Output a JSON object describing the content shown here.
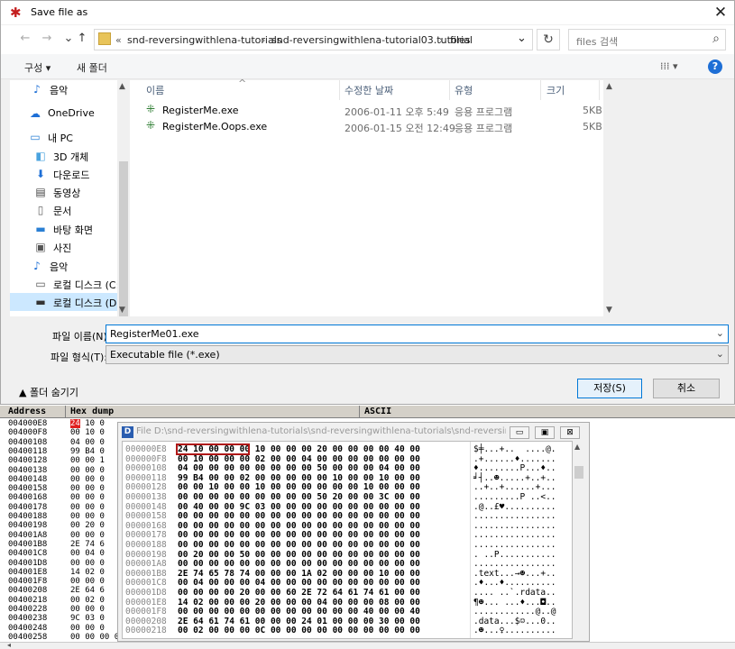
{
  "dialog": {
    "title": "Save file as",
    "close_glyph": "✕",
    "nav": {
      "back": "←",
      "forward": "→",
      "up": "↑"
    },
    "address": {
      "overflow": "«",
      "crumbs": [
        "snd-reversingwithlena-tutorials",
        "snd-reversingwithlena-tutorial03.tutorial",
        "files"
      ],
      "sep": "›",
      "dropdown": "⌄"
    },
    "refresh_glyph": "↻",
    "search_placeholder": "files 검색",
    "search_icon": "⌕",
    "toolbar": {
      "organize": "구성 ▾",
      "new_folder": "새 폴더",
      "view_glyph": "⁞⁞⁞ ▾",
      "help": "?"
    },
    "nav_items": [
      {
        "icon": "music-icon",
        "glyph": "♪",
        "label": "음악",
        "color": "#1e6fd6"
      },
      {
        "icon": "cloud-icon",
        "glyph": "☁",
        "label": "OneDrive",
        "color": "#1e6fd6"
      },
      {
        "icon": "pc-icon",
        "glyph": "▭",
        "label": "내 PC",
        "color": "#2a7fd4"
      },
      {
        "icon": "3d-objects-icon",
        "glyph": "◧",
        "label": "3D 개체",
        "color": "#4aa3df"
      },
      {
        "icon": "download-icon",
        "glyph": "⬇",
        "label": "다운로드",
        "color": "#1e6fd6"
      },
      {
        "icon": "video-icon",
        "glyph": "▤",
        "label": "동영상",
        "color": "#444"
      },
      {
        "icon": "document-icon",
        "glyph": "▯",
        "label": "문서",
        "color": "#666"
      },
      {
        "icon": "desktop-icon",
        "glyph": "▬",
        "label": "바탕 화면",
        "color": "#2a7fd4"
      },
      {
        "icon": "picture-icon",
        "glyph": "▣",
        "label": "사진",
        "color": "#555"
      },
      {
        "icon": "music-icon",
        "glyph": "♪",
        "label": "음악",
        "color": "#1e6fd6"
      },
      {
        "icon": "disk-icon",
        "glyph": "▭",
        "label": "로컬 디스크 (C:)",
        "color": "#555"
      },
      {
        "icon": "disk-icon",
        "glyph": "▬",
        "label": "로컬 디스크 (D:)",
        "color": "#333"
      }
    ],
    "columns": {
      "name": "이름",
      "modified": "수정한 날짜",
      "type": "유형",
      "size": "크기",
      "sort_glyph": "^"
    },
    "files": [
      {
        "name": "RegisterMe.exe",
        "modified": "2006-01-11 오후 5:49",
        "type": "응용 프로그램",
        "size": "5KB"
      },
      {
        "name": "RegisterMe.Oops.exe",
        "modified": "2006-01-15 오전 12:49",
        "type": "응용 프로그램",
        "size": "5KB"
      }
    ],
    "filename_label": "파일 이름(N):",
    "filename_value": "RegisterMe01.exe",
    "filetype_label": "파일 형식(T):",
    "filetype_value": "Executable file (*.exe)",
    "hide_folders": "▲ 폴더 숨기기",
    "save_button": "저장(S)",
    "cancel_button": "취소"
  },
  "hex": {
    "header": {
      "address": "Address",
      "hexdump": "Hex dump",
      "ascii": "ASCII"
    },
    "bg_rows": [
      {
        "addr": "004000E8",
        "hex": "24 10 0"
      },
      {
        "addr": "004000F8",
        "hex": "00 10 0"
      },
      {
        "addr": "00400108",
        "hex": "04 00 0"
      },
      {
        "addr": "00400118",
        "hex": "99 B4 0"
      },
      {
        "addr": "00400128",
        "hex": "00 00 1"
      },
      {
        "addr": "00400138",
        "hex": "00 00 0"
      },
      {
        "addr": "00400148",
        "hex": "00 00 0"
      },
      {
        "addr": "00400158",
        "hex": "00 00 0"
      },
      {
        "addr": "00400168",
        "hex": "00 00 0"
      },
      {
        "addr": "00400178",
        "hex": "00 00 0"
      },
      {
        "addr": "00400188",
        "hex": "00 00 0"
      },
      {
        "addr": "00400198",
        "hex": "00 20 0"
      },
      {
        "addr": "004001A8",
        "hex": "00 00 0"
      },
      {
        "addr": "004001B8",
        "hex": "2E 74 6"
      },
      {
        "addr": "004001C8",
        "hex": "00 04 0"
      },
      {
        "addr": "004001D8",
        "hex": "00 00 0"
      },
      {
        "addr": "004001E8",
        "hex": "14 02 0"
      },
      {
        "addr": "004001F8",
        "hex": "00 00 0"
      },
      {
        "addr": "00400208",
        "hex": "2E 64 6"
      },
      {
        "addr": "00400218",
        "hex": "00 02 0"
      },
      {
        "addr": "00400228",
        "hex": "00 00 0"
      },
      {
        "addr": "00400238",
        "hex": "9C 03 0"
      },
      {
        "addr": "00400248",
        "hex": "00 00 0"
      },
      {
        "addr": "00400258",
        "hex": "00 00 00 00 00 00 00 00"
      }
    ],
    "file_window": {
      "icon": "D",
      "title": "File D:\\snd-reversingwithlena-tutorials\\snd-reversingwithlena-tutorials\\snd-reversingw...",
      "min": "▭",
      "max": "▣",
      "close": "⊠",
      "rows": [
        {
          "addr": "000000E8",
          "hex": "24 10 00 00 00 10 00 00 00 20 00 00 00 00 40 00",
          "ascii": "$╪...+..  ....@."
        },
        {
          "addr": "000000F8",
          "hex": "00 10 00 00 00 02 00 00 04 00 00 00 00 00 00 00",
          "ascii": ".+......♦......."
        },
        {
          "addr": "00000108",
          "hex": "04 00 00 00 00 00 00 00 00 50 00 00 00 04 00 00",
          "ascii": "♦........P...♦.."
        },
        {
          "addr": "00000118",
          "hex": "99 B4 00 00 02 00 00 00 00 00 10 00 00 10 00 00",
          "ascii": "╛┤..☻.....+..+.."
        },
        {
          "addr": "00000128",
          "hex": "00 00 10 00 00 10 00 00 00 00 00 00 10 00 00 00",
          "ascii": "..+..+......+..."
        },
        {
          "addr": "00000138",
          "hex": "00 00 00 00 00 00 00 00 00 50 20 00 00 3C 00 00",
          "ascii": ".........P ..<.."
        },
        {
          "addr": "00000148",
          "hex": "00 40 00 00 9C 03 00 00 00 00 00 00 00 00 00 00",
          "ascii": ".@..£♥.........."
        },
        {
          "addr": "00000158",
          "hex": "00 00 00 00 00 00 00 00 00 00 00 00 00 00 00 00",
          "ascii": "................"
        },
        {
          "addr": "00000168",
          "hex": "00 00 00 00 00 00 00 00 00 00 00 00 00 00 00 00",
          "ascii": "................"
        },
        {
          "addr": "00000178",
          "hex": "00 00 00 00 00 00 00 00 00 00 00 00 00 00 00 00",
          "ascii": "................"
        },
        {
          "addr": "00000188",
          "hex": "00 00 00 00 00 00 00 00 00 00 00 00 00 00 00 00",
          "ascii": "................"
        },
        {
          "addr": "00000198",
          "hex": "00 20 00 00 50 00 00 00 00 00 00 00 00 00 00 00",
          "ascii": ". ..P..........."
        },
        {
          "addr": "000001A8",
          "hex": "00 00 00 00 00 00 00 00 00 00 00 00 00 00 00 00",
          "ascii": "................"
        },
        {
          "addr": "000001B8",
          "hex": "2E 74 65 78 74 00 00 00 1A 02 00 00 00 10 00 00",
          "ascii": ".text...→☻...+.."
        },
        {
          "addr": "000001C8",
          "hex": "00 04 00 00 00 04 00 00 00 00 00 00 00 00 00 00",
          "ascii": ".♦...♦.........."
        },
        {
          "addr": "000001D8",
          "hex": "00 00 00 00 20 00 00 60 2E 72 64 61 74 61 00 00",
          "ascii": ".... ..`.rdata.."
        },
        {
          "addr": "000001E8",
          "hex": "14 02 00 00 00 20 00 00 00 04 00 00 00 08 00 00",
          "ascii": "¶☻... ...♦...◘.."
        },
        {
          "addr": "000001F8",
          "hex": "00 00 00 00 00 00 00 00 00 00 00 00 40 00 00 40",
          "ascii": "............@..@"
        },
        {
          "addr": "00000208",
          "hex": "2E 64 61 74 61 00 00 00 24 01 00 00 00 30 00 00",
          "ascii": ".data...$☺...0.."
        },
        {
          "addr": "00000218",
          "hex": "00 02 00 00 00 0C 00 00 00 00 00 00 00 00 00 00",
          "ascii": ".☻...♀.........."
        }
      ]
    }
  }
}
